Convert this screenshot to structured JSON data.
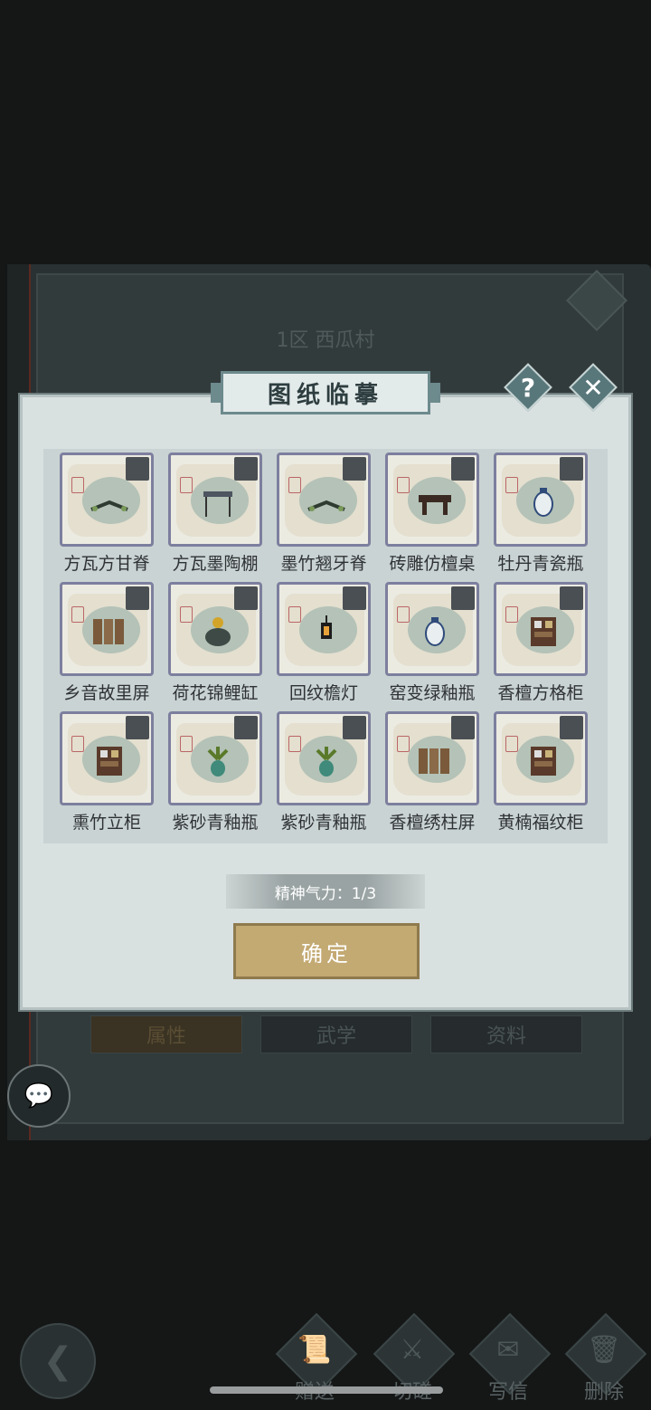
{
  "background": {
    "region_title": "1区  西瓜村",
    "tabs": [
      "属性",
      "武学",
      "资料"
    ]
  },
  "modal": {
    "title": "图纸临摹",
    "help_icon": "question-icon",
    "close_icon": "close-icon",
    "items": [
      {
        "label": "方瓦方甘脊",
        "icon": "ridge-tile-icon"
      },
      {
        "label": "方瓦墨陶棚",
        "icon": "canopy-icon"
      },
      {
        "label": "墨竹翘牙脊",
        "icon": "ridge-tile-icon"
      },
      {
        "label": "砖雕仿檀桌",
        "icon": "table-icon"
      },
      {
        "label": "牡丹青瓷瓶",
        "icon": "vase-icon"
      },
      {
        "label": "乡音故里屏",
        "icon": "screen-icon"
      },
      {
        "label": "荷花锦鲤缸",
        "icon": "jar-icon"
      },
      {
        "label": "回纹檐灯",
        "icon": "lantern-icon"
      },
      {
        "label": "窑变绿釉瓶",
        "icon": "vase-icon"
      },
      {
        "label": "香檀方格柜",
        "icon": "cabinet-icon"
      },
      {
        "label": "熏竹立柜",
        "icon": "cabinet-icon"
      },
      {
        "label": "紫砂青釉瓶",
        "icon": "plant-vase-icon"
      },
      {
        "label": "紫砂青釉瓶",
        "icon": "plant-vase-icon"
      },
      {
        "label": "香檀绣柱屏",
        "icon": "screen-icon"
      },
      {
        "label": "黄楠福纹柜",
        "icon": "cabinet-icon"
      }
    ],
    "stamina_label": "精神气力：1/3",
    "confirm_label": "确定"
  },
  "bottom_nav": [
    {
      "label": "赠送",
      "icon": "scroll-icon"
    },
    {
      "label": "切磋",
      "icon": "sword-icon"
    },
    {
      "label": "写信",
      "icon": "letter-icon"
    },
    {
      "label": "删除",
      "icon": "trash-icon"
    }
  ]
}
